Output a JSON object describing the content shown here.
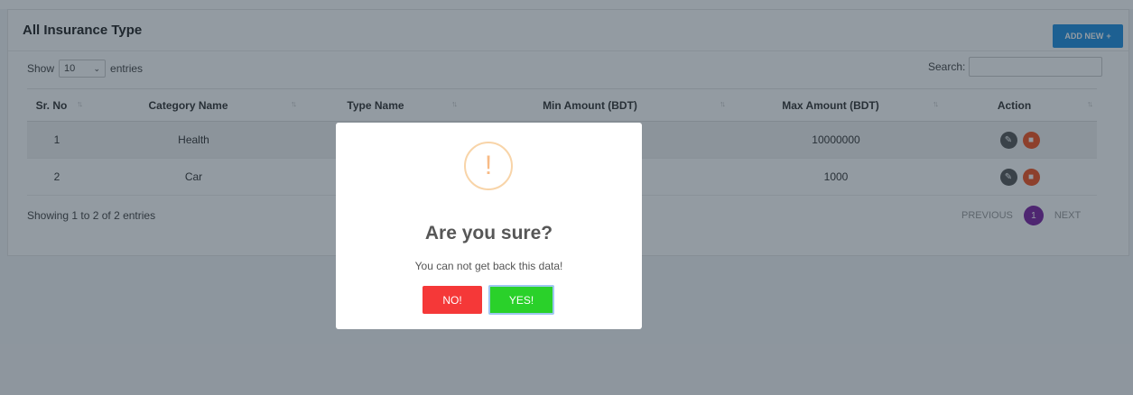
{
  "card": {
    "title": "All Insurance Type",
    "add_label": "ADD NEW",
    "add_icon": "+"
  },
  "controls": {
    "show_label": "Show",
    "entries_value": "10",
    "entries_label": "entries",
    "search_label": "Search:",
    "search_value": ""
  },
  "table": {
    "headers": [
      "Sr. No",
      "Category Name",
      "Type Name",
      "Min Amount (BDT)",
      "Max Amount (BDT)",
      "Action"
    ],
    "rows": [
      {
        "sr": "1",
        "category": "Health",
        "type": "",
        "min": "",
        "max": "10000000"
      },
      {
        "sr": "2",
        "category": "Car",
        "type": "",
        "min": "",
        "max": "1000"
      }
    ]
  },
  "footer": {
    "info": "Showing 1 to 2 of 2 entries",
    "previous": "PREVIOUS",
    "current_page": "1",
    "next": "NEXT"
  },
  "dialog": {
    "icon": "!",
    "title": "Are you sure?",
    "text": "You can not get back this data!",
    "no_label": "NO!",
    "yes_label": "YES!"
  },
  "colors": {
    "add_button": "#1e8fe0",
    "delete_icon": "#f4511e",
    "page_current": "#7b1fa2",
    "no_button": "#f53838",
    "yes_button": "#2ad12a",
    "warning": "#f8bb86"
  }
}
